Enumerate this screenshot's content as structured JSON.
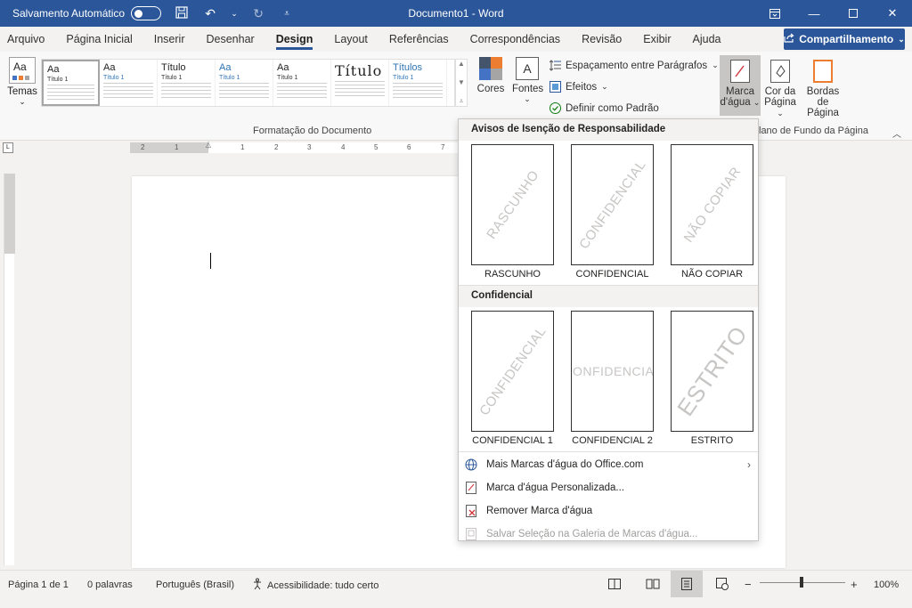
{
  "titlebar": {
    "autosave_label": "Salvamento Automático",
    "autosave_state": "off",
    "doc_title": "Documento1  -  Word"
  },
  "tabs": [
    {
      "label": "Arquivo"
    },
    {
      "label": "Página Inicial"
    },
    {
      "label": "Inserir"
    },
    {
      "label": "Desenhar"
    },
    {
      "label": "Design",
      "active": true
    },
    {
      "label": "Layout"
    },
    {
      "label": "Referências"
    },
    {
      "label": "Correspondências"
    },
    {
      "label": "Revisão"
    },
    {
      "label": "Exibir"
    },
    {
      "label": "Ajuda"
    }
  ],
  "share_label": "Compartilhamento",
  "ribbon": {
    "temas_label": "Temas",
    "temas_icon_text": "Aa",
    "gallery": [
      {
        "big": "Aa",
        "sub": "Título 1"
      },
      {
        "big": "Aa",
        "sub": "Título 1"
      },
      {
        "big": "Título",
        "sub": "Título 1"
      },
      {
        "big": "Aa",
        "sub": "Título 1"
      },
      {
        "big": "Aa",
        "sub": "Título 1"
      },
      {
        "big": "Título",
        "sub": ""
      },
      {
        "big": "Títulos",
        "sub": "Título 1"
      }
    ],
    "cores_label": "Cores",
    "fontes_label": "Fontes",
    "fontes_icon_text": "A",
    "espacamento_label": "Espaçamento entre Parágrafos",
    "efeitos_label": "Efeitos",
    "definir_label": "Definir como Padrão",
    "marca_label_1": "Marca",
    "marca_label_2": "d'água",
    "cor_label_1": "Cor da",
    "cor_label_2": "Página",
    "bordas_label_1": "Bordas",
    "bordas_label_2": "de Página",
    "group_formatacao": "Formatação do Documento",
    "group_plano": "lano de Fundo da Página"
  },
  "ruler_numbers": [
    "2",
    "1",
    "1",
    "2",
    "3",
    "4",
    "5",
    "6",
    "7"
  ],
  "dropdown": {
    "section1_title": "Avisos de Isenção de Responsabilidade",
    "section1_items": [
      {
        "label": "RASCUNHO",
        "watermark": "RASCUNHO"
      },
      {
        "label": "CONFIDENCIAL",
        "watermark": "CONFIDENCIAL"
      },
      {
        "label": "NÃO COPIAR",
        "watermark": "NÃO COPIAR"
      }
    ],
    "section2_title": "Confidencial",
    "section2_items": [
      {
        "label": "CONFIDENCIAL 1",
        "watermark": "CONFIDENCIAL"
      },
      {
        "label": "CONFIDENCIAL 2",
        "watermark": "CONFIDENCIAL"
      },
      {
        "label": "ESTRITO",
        "watermark": "ESTRITO"
      }
    ],
    "menu": [
      {
        "label": "Mais Marcas d'água do Office.com",
        "icon": "globe-icon",
        "submenu": true
      },
      {
        "label": "Marca d'água Personalizada...",
        "icon": "watermark-doc-icon"
      },
      {
        "label": "Remover Marca d'água",
        "icon": "remove-watermark-icon"
      },
      {
        "label": "Salvar Seleção na Galeria de Marcas d'água...",
        "icon": "save-gallery-icon",
        "disabled": true
      }
    ]
  },
  "statusbar": {
    "page": "Página 1 de 1",
    "words": "0 palavras",
    "language": "Português (Brasil)",
    "accessibility": "Acessibilidade: tudo certo",
    "zoom": "100%",
    "zoom_minus": "−",
    "zoom_plus": "+"
  },
  "colors": {
    "brand": "#2b579a",
    "ribbon_bg": "#f8f8f8",
    "watermark_gray": "#c8c6c4"
  }
}
